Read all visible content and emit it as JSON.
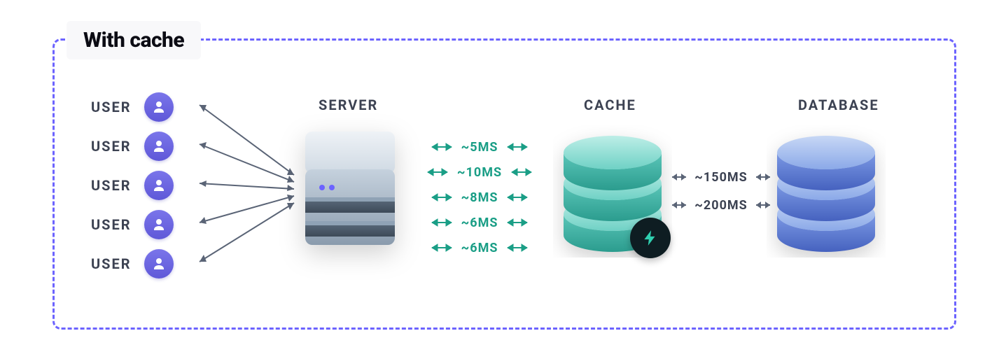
{
  "title": "With cache",
  "users": {
    "label": "USER",
    "count": 5
  },
  "nodes": {
    "server": "SERVER",
    "cache": "CACHE",
    "database": "DATABASE"
  },
  "cache_timings_ms": [
    "~5MS",
    "~10MS",
    "~8MS",
    "~6MS",
    "~6MS"
  ],
  "db_timings_ms": [
    "~150MS",
    "~200MS"
  ],
  "colors": {
    "border": "#6c63ff",
    "teal": "#1a9e86",
    "grey_arrow": "#5a6476",
    "label": "#3c4252",
    "cache_fill_light": "#a6e5de",
    "cache_fill_dark": "#3fbcb0",
    "db_fill_light": "#a9c3f2",
    "db_fill_dark": "#5b7edb"
  }
}
